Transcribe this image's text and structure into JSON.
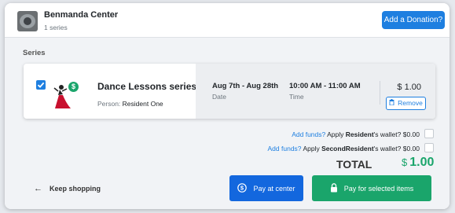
{
  "header": {
    "center_name": "Benmanda Center",
    "series_count": "1 series",
    "donate_label": "Add a Donation?"
  },
  "section": {
    "series_label": "Series"
  },
  "item": {
    "title": "Dance Lessons series",
    "person_label": "Person:",
    "person_name": "Resident One",
    "date_value": "Aug 7th - Aug 28th",
    "date_label": "Date",
    "time_value": "10:00 AM - 11:00 AM",
    "time_label": "Time",
    "price": "$ 1.00",
    "remove_label": "Remove",
    "checked": true,
    "dollar_badge": "$"
  },
  "wallets": [
    {
      "link": "Add funds?",
      "prefix": "Apply",
      "name": "Resident",
      "suffix": "'s wallet? $0.00"
    },
    {
      "link": "Add funds?",
      "prefix": "Apply",
      "name": "SecondResident",
      "suffix": "'s wallet? $0.00"
    }
  ],
  "total": {
    "label": "TOTAL",
    "currency": "$",
    "amount": "1.00"
  },
  "footer": {
    "keep_shopping": "Keep shopping",
    "pay_center": "Pay at center",
    "pay_selected": "Pay for selected items"
  },
  "colors": {
    "primary": "#1e7fe0",
    "success": "#1aa56b",
    "pay_center_bg": "#1367de"
  },
  "icons": {
    "avatar": "center-avatar-image",
    "dancer": "dancer-image",
    "remove": "trash-icon",
    "back": "arrow-left-icon",
    "pay_center": "dollar-coin-icon",
    "pay_selected": "lock-icon"
  }
}
